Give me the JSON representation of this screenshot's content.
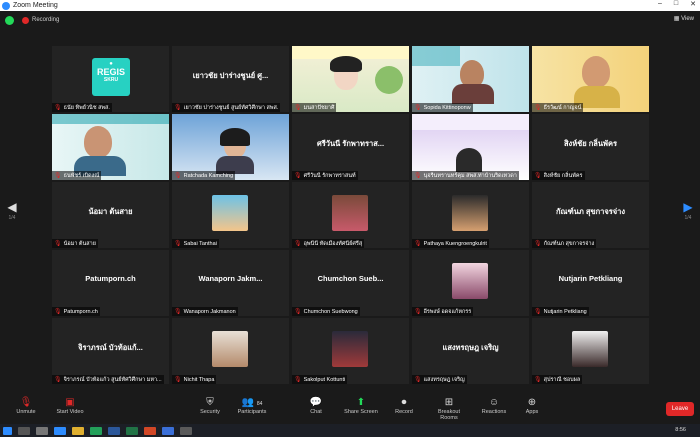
{
  "window": {
    "title": "Zoom Meeting",
    "controls": [
      "–",
      "□",
      "✕"
    ]
  },
  "top": {
    "recording_label": "Recording",
    "view_label": "View"
  },
  "pager": {
    "left_page": "1/4",
    "right_page": "1/4"
  },
  "colors": {
    "accent": "#2d8cff",
    "leave": "#e02828",
    "recording": "#e02828",
    "shield": "#23d959",
    "speaker_highlight": "#f5e33a"
  },
  "tiles": [
    {
      "name": "ธนัย ทิพย์วนิช สพส.",
      "type": "logo",
      "logo_text": "REGIS",
      "logo_sub": "SKRU"
    },
    {
      "name": "เยาวชัย ปาร่างชูนย์ สูนย์ทัศวิศึกษา สพส.",
      "type": "text",
      "big": "เยาวชัย ปาร่างชูนย์ ศู..."
    },
    {
      "name": "มนสาปัชยาศิ",
      "type": "video",
      "scene": "cartoon"
    },
    {
      "name": "Sopida Kittinoponw",
      "type": "video",
      "scene": "man1"
    },
    {
      "name": "ธีรวัฒน์ กาญจน์",
      "type": "video",
      "scene": "man2",
      "highlight": true
    },
    {
      "name": "ธนพัชร์ เบิดงณ์",
      "type": "video",
      "scene": "man3"
    },
    {
      "name": "Ratchada Kamching",
      "type": "video",
      "scene": "woman1"
    },
    {
      "name": "ศรีวันนี รักพาทราสนท์",
      "type": "text",
      "big": "ศรีวันนี รักพาทราส..."
    },
    {
      "name": "นุจรีนทรานทร์คุม สพส.ท่าบ้านริดเทวดา",
      "type": "video",
      "scene": "banner"
    },
    {
      "name": "สิงห์ชัย กลิ่นพัคร",
      "type": "text",
      "big": "สิงห์ชัย กลิ่นพัคร"
    },
    {
      "name": "น้อมา ต้นสาย",
      "type": "text",
      "big": "น้อมา ต้นสาย"
    },
    {
      "name": "Sabai Tanthai",
      "type": "avatar",
      "avatar": "a1"
    },
    {
      "name": "อุพนีนี ทัดเมืองทัศนีย์ศรีสุ",
      "type": "avatar",
      "avatar": "a2"
    },
    {
      "name": "Pathaya Kuengroengkulrit",
      "type": "avatar",
      "avatar": "a3"
    },
    {
      "name": "กัณฑ์นภ สุขกาจรจ่าง",
      "type": "text",
      "big": "กัณฑ์นภ สุขกาจรจ่าง"
    },
    {
      "name": "Patumporn.ch",
      "type": "text",
      "big": "Patumporn.ch"
    },
    {
      "name": "Wanaporn Jakmanon",
      "type": "text",
      "big": "Wanaporn Jakm..."
    },
    {
      "name": "Chumchon Suebwong",
      "type": "text",
      "big": "Chumchon Sueb..."
    },
    {
      "name": "อีรพงษ์ อดจแก้หกรร",
      "type": "avatar",
      "avatar": "a4"
    },
    {
      "name": "Nutjarin Petkliang",
      "type": "text",
      "big": "Nutjarin Petkliang"
    },
    {
      "name": "จิราภรณ์ บัวท้อแก้ว สูนย์ทัศวิศึกษา มหา...",
      "type": "text",
      "big": "จิราภรณ์ บัวท้อแก้..."
    },
    {
      "name": "Nichit Thapa",
      "type": "avatar",
      "avatar": "a5"
    },
    {
      "name": "Sakolput Kottunti",
      "type": "avatar",
      "avatar": "a6"
    },
    {
      "name": "แสงทรฤษฎ เจริญ",
      "type": "text",
      "big": "แสงทรฤษฎ เจริญ"
    },
    {
      "name": "สุปราณี ชอบผล",
      "type": "avatar",
      "avatar": "a7"
    }
  ],
  "toolbar": [
    {
      "label": "Unmute",
      "icon": "microphone-muted-icon"
    },
    {
      "label": "Start Video",
      "icon": "video-off-icon"
    },
    {
      "label": "Security",
      "icon": "shield-icon"
    },
    {
      "label": "Participants",
      "icon": "participants-icon",
      "count": "84"
    },
    {
      "label": "Chat",
      "icon": "chat-icon"
    },
    {
      "label": "Share Screen",
      "icon": "share-screen-icon"
    },
    {
      "label": "Record",
      "icon": "record-icon"
    },
    {
      "label": "Breakout Rooms",
      "icon": "breakout-rooms-icon"
    },
    {
      "label": "Reactions",
      "icon": "reactions-icon"
    },
    {
      "label": "Apps",
      "icon": "apps-icon"
    }
  ],
  "leave_label": "Leave",
  "taskbar": {
    "clock": "8:56"
  }
}
